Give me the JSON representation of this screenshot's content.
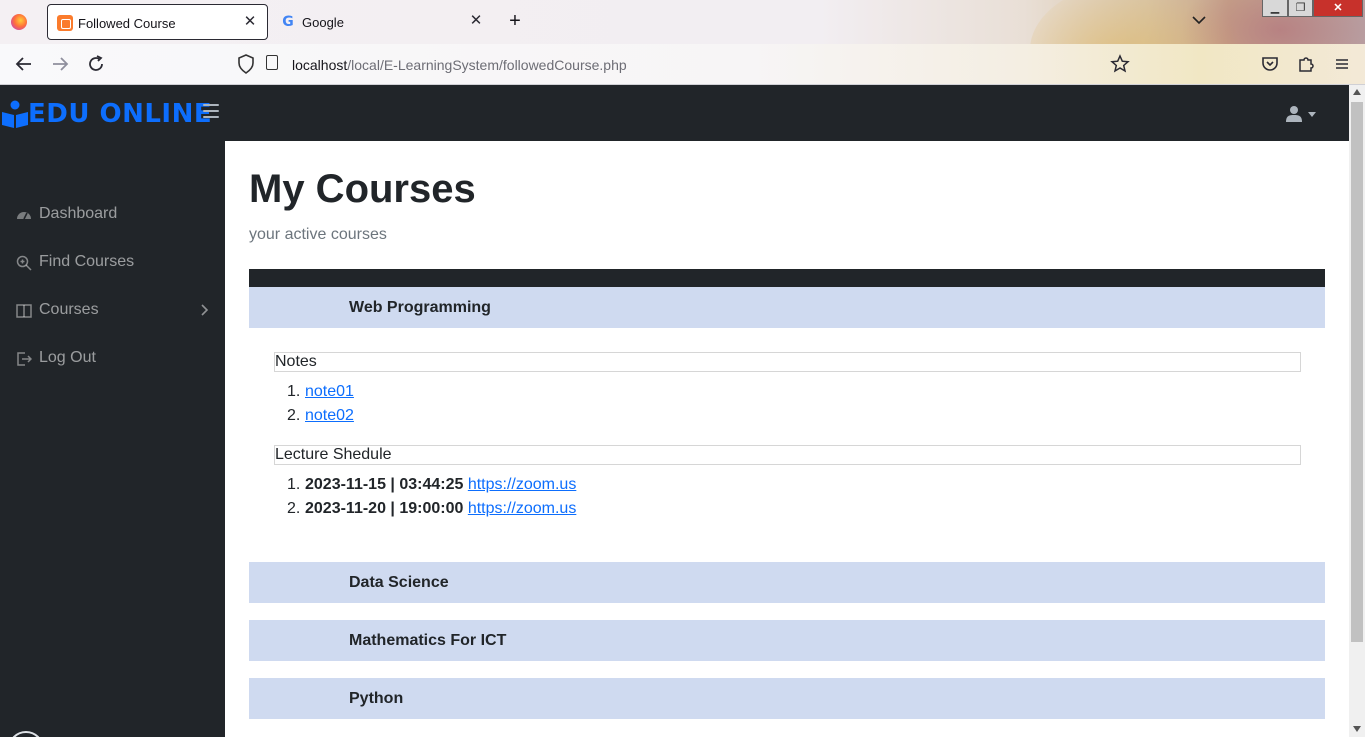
{
  "browser": {
    "tabs": [
      {
        "title": "Followed Course",
        "favicon": "xampp-icon",
        "active": true
      },
      {
        "title": "Google",
        "favicon": "google-icon",
        "active": false
      }
    ],
    "close_glyph": "✕",
    "new_tab_glyph": "+",
    "url": {
      "host": "localhost",
      "path": "/local/E-LearningSystem/followedCourse.php"
    }
  },
  "app": {
    "brand": "EDU ONLINE",
    "brand_color": "#0d6efd",
    "sidebar_bg": "#212529"
  },
  "sidebar": {
    "items": [
      {
        "label": "Dashboard",
        "icon": "tachometer-icon"
      },
      {
        "label": "Find Courses",
        "icon": "search-plus-icon"
      },
      {
        "label": "Courses",
        "icon": "columns-icon",
        "has_submenu": true
      },
      {
        "label": "Log Out",
        "icon": "sign-out-icon"
      }
    ]
  },
  "main": {
    "title": "My Courses",
    "subtitle": "your active courses",
    "courses": [
      {
        "name": "Web Programming",
        "expanded": true
      },
      {
        "name": "Data Science"
      },
      {
        "name": "Mathematics For ICT"
      },
      {
        "name": "Python"
      }
    ],
    "expanded": {
      "notes_heading": "Notes",
      "notes": [
        {
          "num": "1.",
          "label": "note01"
        },
        {
          "num": "2.",
          "label": "note02"
        }
      ],
      "schedule_heading": "Lecture Shedule",
      "schedule": [
        {
          "num": "1.",
          "datetime": "2023-11-15 | 03:44:25",
          "link": "https://zoom.us"
        },
        {
          "num": "2.",
          "datetime": "2023-11-20 | 19:00:00",
          "link": "https://zoom.us"
        }
      ]
    },
    "row_color": "#cfdaf0"
  }
}
